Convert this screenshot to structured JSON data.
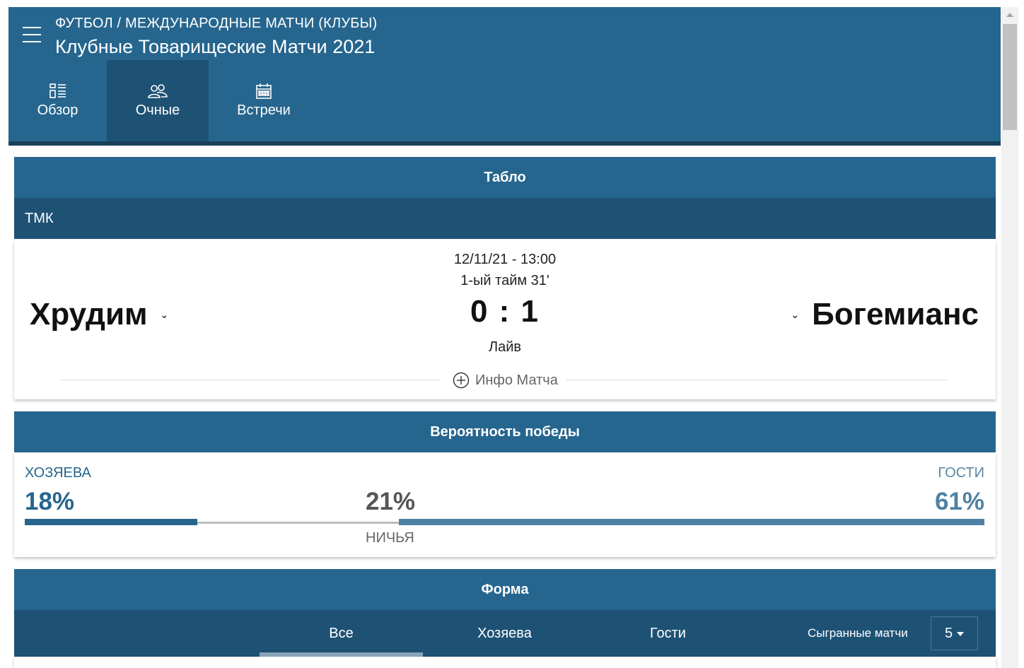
{
  "header": {
    "breadcrumb": "ФУТБОЛ / МЕЖДУНАРОДНЫЕ МАТЧИ (КЛУБЫ)",
    "title": "Клубные Товарищеские Матчи 2021",
    "tabs": [
      {
        "label": "Обзор",
        "icon": "overview-icon",
        "active": false
      },
      {
        "label": "Очные",
        "icon": "users-icon",
        "active": true
      },
      {
        "label": "Встречи",
        "icon": "calendar-icon",
        "active": false
      }
    ]
  },
  "scoreboard": {
    "heading": "Табло",
    "league": "ТМК",
    "date": "12/11/21 - 13:00",
    "period": "1-ый тайм 31'",
    "home_team": "Хрудим",
    "away_team": "Богемианс",
    "score": "0 : 1",
    "status": "Лайв",
    "info_label": "Инфо Матча"
  },
  "win_probability": {
    "heading": "Вероятность победы",
    "home_label": "ХОЗЯЕВА",
    "away_label": "ГОСТИ",
    "draw_label": "НИЧЬЯ",
    "home_pct": "18%",
    "draw_pct": "21%",
    "away_pct": "61%",
    "home_value": 18,
    "draw_value": 21,
    "away_value": 61
  },
  "form": {
    "heading": "Форма",
    "tabs": [
      {
        "label": "Все",
        "active": true
      },
      {
        "label": "Хозяева",
        "active": false
      },
      {
        "label": "Гости",
        "active": false
      }
    ],
    "played_label": "Сыгранные матчи",
    "played_value": "5"
  },
  "colors": {
    "primary": "#26668e",
    "dark": "#1e5275",
    "away_bar": "#4f82a2",
    "draw_bar": "#bdbdbd"
  }
}
